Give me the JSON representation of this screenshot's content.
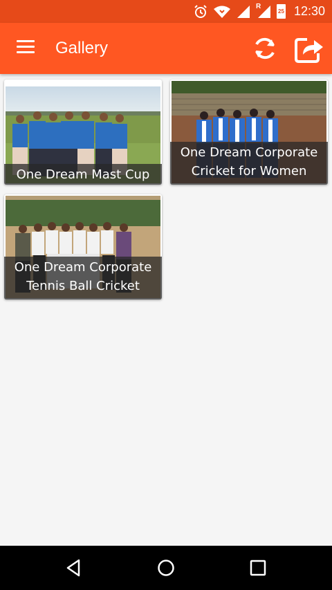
{
  "status_bar": {
    "time": "12:30",
    "battery_level": "25",
    "network_badge": "R",
    "icons": [
      "alarm-icon",
      "wifi-icon",
      "signal-icon",
      "signal-roaming-icon",
      "battery-icon"
    ]
  },
  "app_bar": {
    "title": "Gallery",
    "color": "#ff5722",
    "actions": [
      "refresh-icon",
      "share-icon"
    ]
  },
  "gallery": {
    "items": [
      {
        "caption": "One Dream Mast Cup"
      },
      {
        "caption": "One Dream Corporate Cricket for Women"
      },
      {
        "caption": "One Dream Corporate Tennis Ball Cricket"
      }
    ]
  },
  "nav_bar": {
    "buttons": [
      "back-icon",
      "home-icon",
      "recents-icon"
    ]
  }
}
